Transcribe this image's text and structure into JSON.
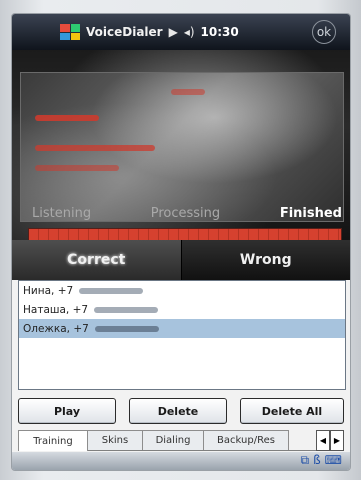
{
  "titlebar": {
    "app_title": "VoiceDialer",
    "clock": "10:30",
    "close_label": "ok"
  },
  "recognition": {
    "stages": [
      "Listening",
      "Processing",
      "Finished"
    ],
    "active_stage": "Finished",
    "progress": 1.0
  },
  "choices": {
    "correct_label": "Correct",
    "wrong_label": "Wrong"
  },
  "list": {
    "items": [
      {
        "label": "Нина, +7",
        "selected": false
      },
      {
        "label": "Наташа, +7",
        "selected": false
      },
      {
        "label": "Олежка, +7",
        "selected": true
      }
    ]
  },
  "actions": {
    "play_label": "Play",
    "delete_label": "Delete",
    "delete_all_label": "Delete All"
  },
  "tabs": {
    "items": [
      "Training",
      "Skins",
      "Dialing",
      "Backup/Res"
    ],
    "active": "Training"
  },
  "icons": {
    "start": "windows-logo-icon",
    "close": "close-icon",
    "tray": [
      "connectivity-icon",
      "bluetooth-icon",
      "keyboard-icon"
    ]
  },
  "colors": {
    "accent": "#d6412f",
    "selection": "#a7c3dd"
  }
}
